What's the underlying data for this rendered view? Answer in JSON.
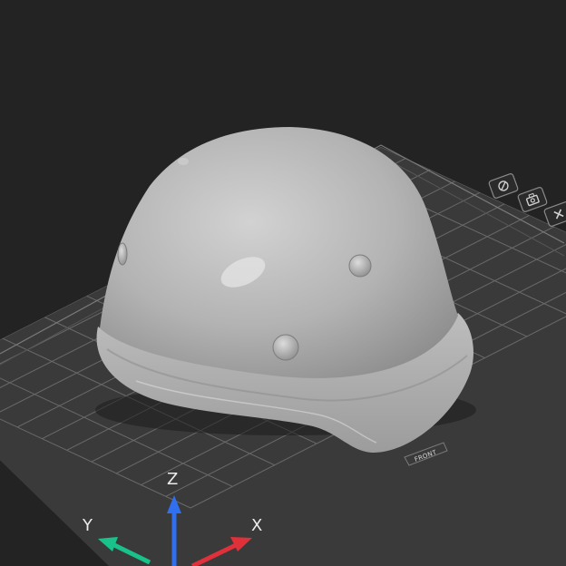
{
  "viewport": {
    "background_color": "#232324",
    "plate_color": "#3a3a3b",
    "grid_color": "#6a6a6c",
    "model_color": "#b5b5b5"
  },
  "plate": {
    "front_label": "FRONT"
  },
  "model": {
    "kind": "helmet"
  },
  "view_controls": [
    {
      "icon": "view-toggle-icon"
    },
    {
      "icon": "camera-icon"
    },
    {
      "icon": "close-icon"
    }
  ],
  "axes": {
    "x": {
      "label": "X",
      "color": "#e0303a"
    },
    "y": {
      "label": "Y",
      "color": "#19c28a"
    },
    "z": {
      "label": "Z",
      "color": "#2f6ff0"
    }
  }
}
